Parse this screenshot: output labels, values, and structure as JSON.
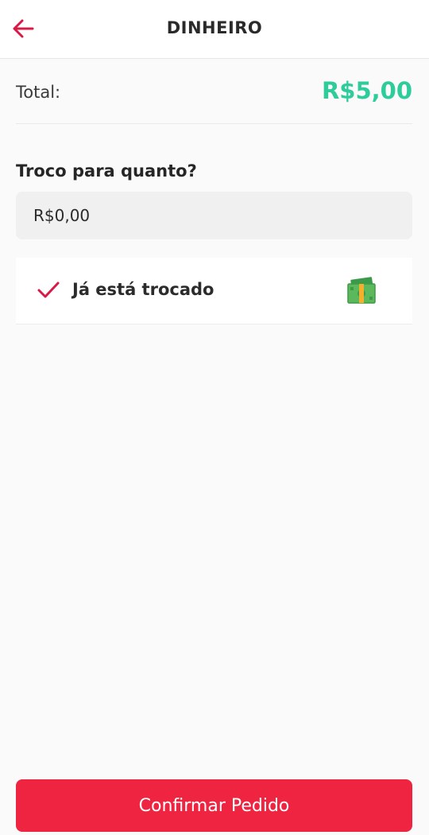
{
  "header": {
    "title": "DINHEIRO",
    "back_icon": "arrow-left-icon"
  },
  "summary": {
    "total_label": "Total:",
    "total_value": "R$5,00"
  },
  "change": {
    "label": "Troco para quanto?",
    "value": "R$0,00"
  },
  "option": {
    "label": "Já está trocado",
    "checked": true,
    "check_icon": "checkmark-icon",
    "money_icon": "cash-icon"
  },
  "footer": {
    "confirm_label": "Confirmar Pedido"
  },
  "colors": {
    "accent": "#ee2440",
    "total": "#2ecc9a",
    "icon_red": "#d81b46"
  }
}
